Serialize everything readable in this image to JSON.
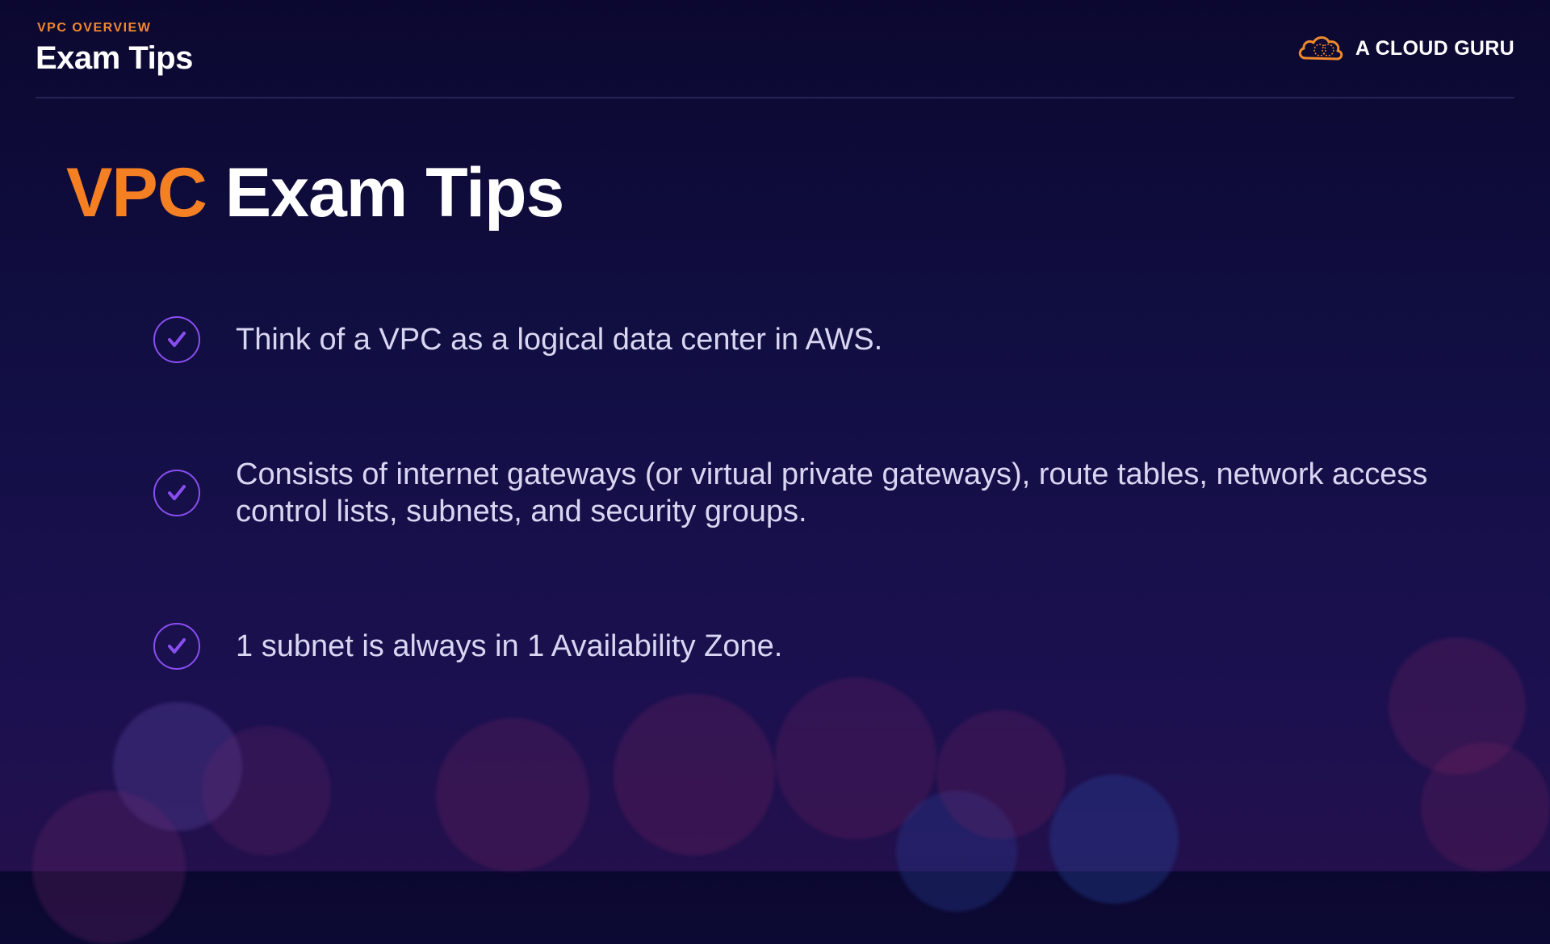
{
  "header": {
    "kicker": "VPC OVERVIEW",
    "title": "Exam Tips",
    "brand_name": "A CLOUD GURU",
    "brand_icon": "cloud-icon"
  },
  "slide": {
    "title_accent": "VPC",
    "title_rest": "Exam Tips",
    "tips": [
      {
        "icon": "check-circle-icon",
        "text": "Think of a VPC as a logical data center in AWS."
      },
      {
        "icon": "check-circle-icon",
        "text": "Consists of internet gateways (or virtual private gateways), route tables, network access control lists, subnets, and security groups."
      },
      {
        "icon": "check-circle-icon",
        "text": "1 subnet is always in 1 Availability Zone."
      }
    ]
  },
  "colors": {
    "background": "#120f45",
    "accent_orange": "#f58023",
    "check_purple": "#8a4ef0",
    "text": "#d9d6f2"
  }
}
